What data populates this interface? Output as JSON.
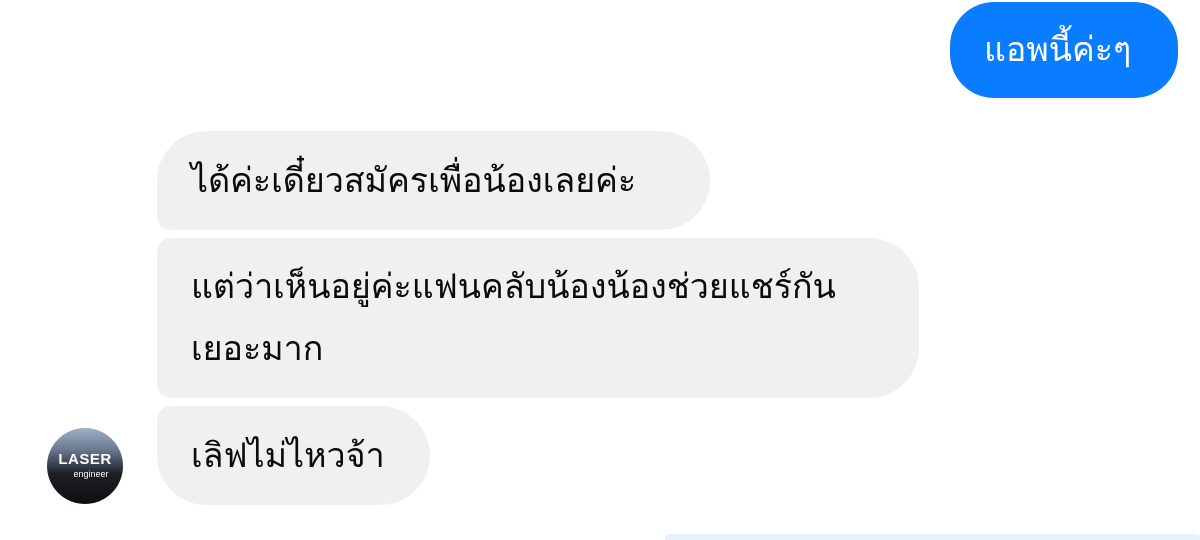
{
  "messages": {
    "outgoing": [
      {
        "text": "แอพนี้ค่ะๆ"
      }
    ],
    "incoming": [
      {
        "text": "ได้ค่ะเดี๋ยวสมัครเพื่อน้องเลยค่ะ"
      },
      {
        "text": "แต่ว่าเห็นอยู่ค่ะแฟนคลับน้องน้องช่วยแชร์กันเยอะมาก"
      },
      {
        "text": "เลิฟไม่ไหวจ้า"
      }
    ]
  },
  "contact": {
    "avatar_logo_text": "LASER",
    "avatar_logo_subtext": "engineer"
  },
  "colors": {
    "outgoing_bubble": "#0a7cff",
    "incoming_bubble": "#f0f0f3"
  }
}
